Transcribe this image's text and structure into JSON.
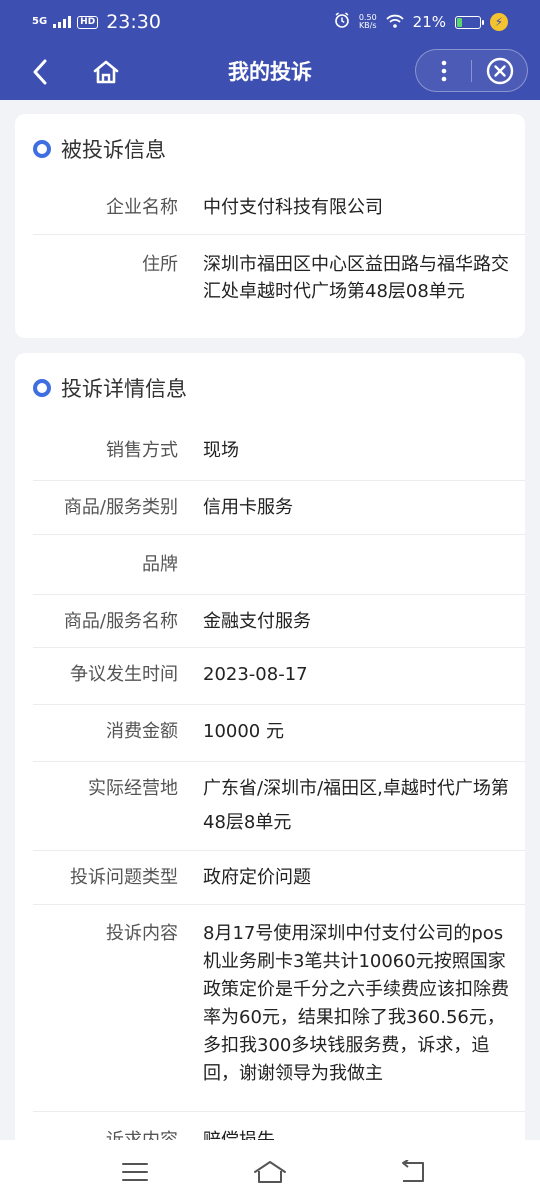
{
  "status_bar": {
    "network": "5G",
    "hd": "HD",
    "time": "23:30",
    "speed_value": "0.50",
    "speed_unit": "KB/s",
    "battery_percent": "21%",
    "battery_level": 0.21
  },
  "nav": {
    "title": "我的投诉"
  },
  "section_complainee": {
    "title": "被投诉信息",
    "fields": [
      {
        "label": "企业名称",
        "value": "中付支付科技有限公司"
      },
      {
        "label": "住所",
        "value": "深圳市福田区中心区益田路与福华路交汇处卓越时代广场第48层08单元"
      }
    ]
  },
  "section_details": {
    "title": "投诉详情信息",
    "fields": [
      {
        "label": "销售方式",
        "value": "现场"
      },
      {
        "label": "商品/服务类别",
        "value": "信用卡服务"
      },
      {
        "label": "品牌",
        "value": ""
      },
      {
        "label": "商品/服务名称",
        "value": "金融支付服务"
      },
      {
        "label": "争议发生时间",
        "value": "2023-08-17"
      },
      {
        "label": "消费金额",
        "value": "10000 元"
      },
      {
        "label": "实际经营地",
        "value": "广东省/深圳市/福田区,卓越时代广场第48层8单元"
      },
      {
        "label": "投诉问题类型",
        "value": "政府定价问题"
      },
      {
        "label": "投诉内容",
        "value": "8月17号使用深圳中付支付公司的pos机业务刷卡3笔共计10060元按照国家政策定价是千分之六手续费应该扣除费率为60元，结果扣除了我360.56元，多扣我300多块钱服务费，诉求，追回，谢谢领导为我做主"
      },
      {
        "label": "诉求内容",
        "value": "赔偿损失"
      }
    ]
  },
  "colors": {
    "primary": "#3d4fb0",
    "accent_dot": "#3f6ee0",
    "background": "#f2f3f7"
  },
  "icons": {
    "back": "chevron-left-icon",
    "home": "home-icon",
    "more": "more-vertical-icon",
    "close": "close-circle-icon",
    "menu": "menu-icon",
    "nav_home": "nav-home-icon",
    "nav_back": "nav-back-icon"
  }
}
